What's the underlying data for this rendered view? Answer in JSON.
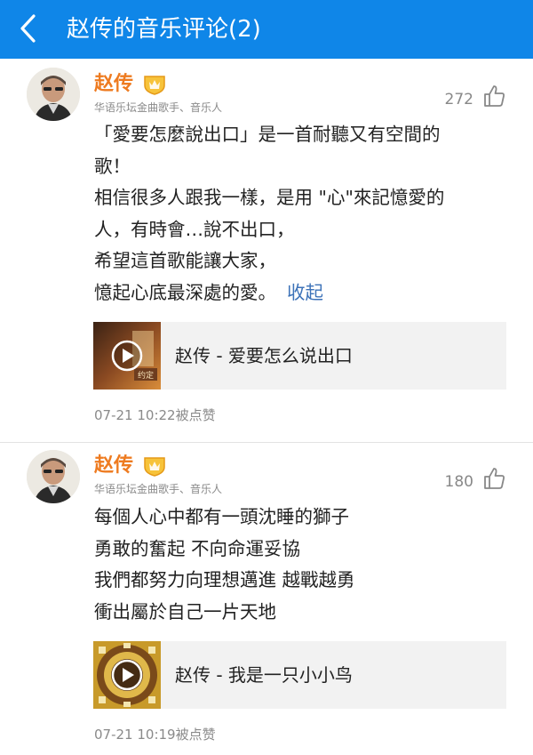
{
  "header": {
    "title": "赵传的音乐评论(2)",
    "back_icon": "chevron-left-icon",
    "background": "#0f86e8"
  },
  "comments": [
    {
      "author": "赵传",
      "badge_icon": "crown-badge-icon",
      "subtitle": "华语乐坛金曲歌手、音乐人",
      "likes": "272",
      "lines": [
        "「愛要怎麼說出口」是一首耐聽又有空間的",
        "歌！",
        "相信很多人跟我一樣，是用 \"心\"來記憶愛的",
        "人，有時會…說不出口，",
        "希望這首歌能讓大家，",
        "憶起心底最深處的愛。"
      ],
      "collapse_label": "收起",
      "song": "赵传 - 爱要怎么说出口",
      "cover_text": "约定",
      "meta": "07-21 10:22被点赞"
    },
    {
      "author": "赵传",
      "badge_icon": "crown-badge-icon",
      "subtitle": "华语乐坛金曲歌手、音乐人",
      "likes": "180",
      "lines": [
        "每個人心中都有一頭沈睡的獅子",
        "勇敢的奮起  不向命運妥協",
        "我們都努力向理想邁進 越戰越勇",
        "衝出屬於自己一片天地"
      ],
      "song": "赵传 - 我是一只小小鸟",
      "meta": "07-21 10:19被点赞"
    }
  ],
  "colors": {
    "accent_name": "#ee7b20",
    "link": "#3c72b8",
    "muted": "#8a8a8a"
  }
}
